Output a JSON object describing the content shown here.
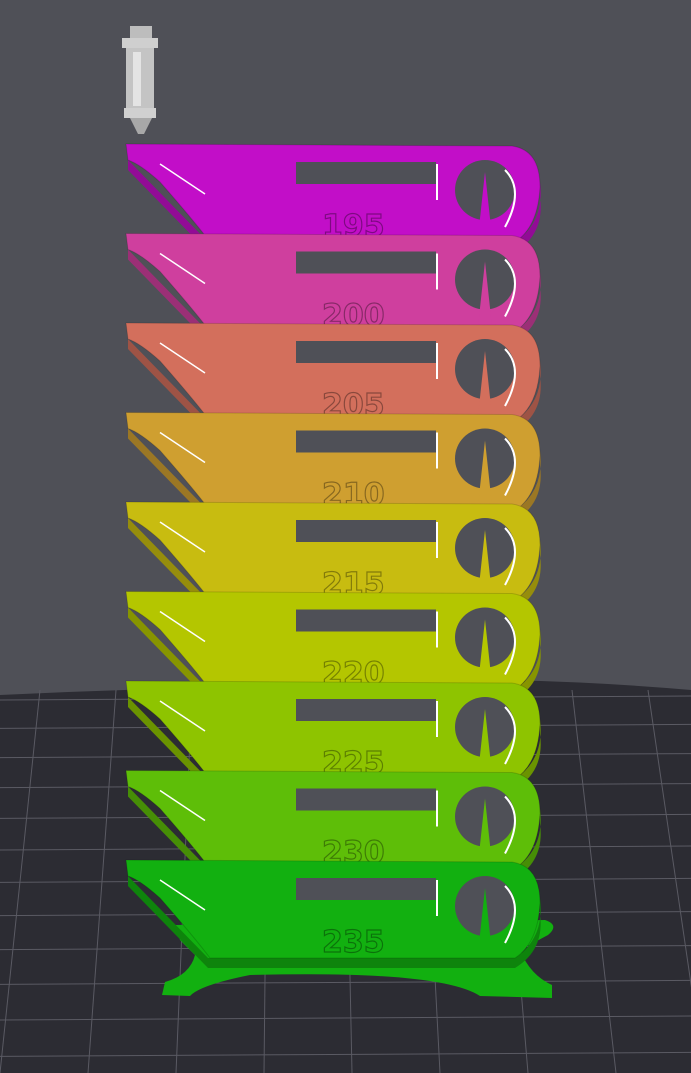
{
  "view": {
    "background": "#4f5057",
    "bed_color": "#2c2c33",
    "grid_color": "#5a5a63"
  },
  "tower": {
    "segments": [
      {
        "label": "195",
        "color": "#c20ec8"
      },
      {
        "label": "200",
        "color": "#cf3f9e"
      },
      {
        "label": "205",
        "color": "#d36f5c"
      },
      {
        "label": "210",
        "color": "#cf9f30"
      },
      {
        "label": "215",
        "color": "#c8bc10"
      },
      {
        "label": "220",
        "color": "#b4c600"
      },
      {
        "label": "225",
        "color": "#8ec400"
      },
      {
        "label": "230",
        "color": "#5ebe08"
      },
      {
        "label": "235",
        "color": "#12b010"
      }
    ]
  },
  "nozzle": {
    "icon": "nozzle-icon"
  }
}
